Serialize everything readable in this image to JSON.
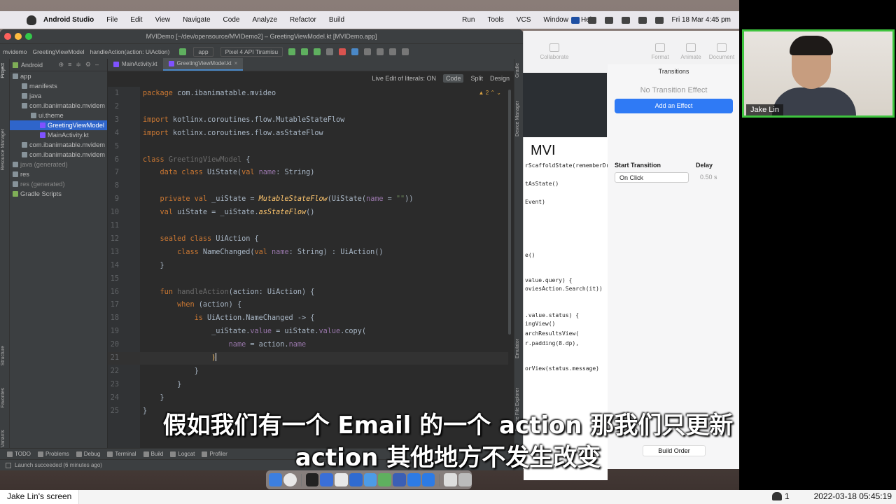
{
  "menubar": {
    "app_name": "Android Studio",
    "items": [
      "File",
      "Edit",
      "View",
      "Navigate",
      "Code",
      "Analyze",
      "Refactor",
      "Build",
      "Run",
      "Tools",
      "VCS",
      "Window",
      "Help"
    ],
    "clock": "Fri 18 Mar  4:45 pm"
  },
  "window": {
    "title": "MVIDemo [~/dev/opensource/MVIDemo2] – GreetingViewModel.kt [MVIDemo.app]"
  },
  "navbar": {
    "crumbs": [
      "mvidemo",
      "GreetingViewModel",
      "handleAction(action: UiAction)"
    ],
    "run_config": "app",
    "device": "Pixel 4 API Tiramisu"
  },
  "project": {
    "view_mode": "Android",
    "tree": [
      {
        "label": "app",
        "indent": 0,
        "icon": "folder-icon"
      },
      {
        "label": "manifests",
        "indent": 1,
        "icon": "folder-icon"
      },
      {
        "label": "java",
        "indent": 1,
        "icon": "folder-icon"
      },
      {
        "label": "com.ibanimatable.mvidem",
        "indent": 1,
        "icon": "package-icon"
      },
      {
        "label": "ui.theme",
        "indent": 2,
        "icon": "package-icon"
      },
      {
        "label": "GreetingViewModel",
        "indent": 3,
        "icon": "kotlin-file-icon",
        "selected": true
      },
      {
        "label": "MainActivity.kt",
        "indent": 3,
        "icon": "kotlin-file-icon"
      },
      {
        "label": "com.ibanimatable.mvidem",
        "indent": 1,
        "icon": "package-icon"
      },
      {
        "label": "com.ibanimatable.mvidem",
        "indent": 1,
        "icon": "package-icon"
      },
      {
        "label": "java (generated)",
        "indent": 0,
        "icon": "folder-icon",
        "gen": true
      },
      {
        "label": "res",
        "indent": 0,
        "icon": "folder-icon"
      },
      {
        "label": "res (generated)",
        "indent": 0,
        "icon": "folder-icon",
        "gen": true
      },
      {
        "label": "Gradle Scripts",
        "indent": 0,
        "icon": "gradle-icon"
      }
    ],
    "side_tabs": [
      "Project",
      "Resource Manager",
      "Structure",
      "Favorites",
      "Build Variants"
    ]
  },
  "editor": {
    "tabs": [
      {
        "label": "MainActivity.kt",
        "active": false
      },
      {
        "label": "GreetingViewModel.kt",
        "active": true
      }
    ],
    "live_edit": "Live Edit of literals: ON",
    "modes": [
      "Code",
      "Split",
      "Design"
    ],
    "warning_count": "2",
    "current_line": 21,
    "lines": [
      [
        [
          "k",
          "package "
        ],
        [
          "t",
          "com.ibanimatable.mvideo"
        ]
      ],
      [],
      [
        [
          "k",
          "import "
        ],
        [
          "t",
          "kotlinx.coroutines.flow.MutableStateFlow"
        ]
      ],
      [
        [
          "k",
          "import "
        ],
        [
          "t",
          "kotlinx.coroutines.flow.asStateFlow"
        ]
      ],
      [],
      [
        [
          "k",
          "class "
        ],
        [
          "g",
          "GreetingViewModel"
        ],
        [
          "t",
          " {"
        ]
      ],
      [
        [
          "t",
          "    "
        ],
        [
          "k",
          "data class "
        ],
        [
          "t",
          "UiState("
        ],
        [
          "k",
          "val "
        ],
        [
          "p",
          "name"
        ],
        [
          "t",
          ": String)"
        ]
      ],
      [],
      [
        [
          "t",
          "    "
        ],
        [
          "k",
          "private val "
        ],
        [
          "t",
          "_uiState = "
        ],
        [
          "i",
          "MutableStateFlow"
        ],
        [
          "t",
          "(UiState("
        ],
        [
          "p",
          "name"
        ],
        [
          "t",
          " = "
        ],
        [
          "s",
          "\"\""
        ],
        [
          "t",
          "))"
        ]
      ],
      [
        [
          "t",
          "    "
        ],
        [
          "k",
          "val "
        ],
        [
          "t",
          "uiState = _uiState."
        ],
        [
          "i",
          "asStateFlow"
        ],
        [
          "t",
          "()"
        ]
      ],
      [],
      [
        [
          "t",
          "    "
        ],
        [
          "k",
          "sealed class "
        ],
        [
          "t",
          "UiAction {"
        ]
      ],
      [
        [
          "t",
          "        "
        ],
        [
          "k",
          "class "
        ],
        [
          "t",
          "NameChanged("
        ],
        [
          "k",
          "val "
        ],
        [
          "p",
          "name"
        ],
        [
          "t",
          ": String) : UiAction()"
        ]
      ],
      [
        [
          "t",
          "    }"
        ]
      ],
      [],
      [
        [
          "t",
          "    "
        ],
        [
          "k",
          "fun "
        ],
        [
          "g",
          "handleAction"
        ],
        [
          "t",
          "(action: UiAction) {"
        ]
      ],
      [
        [
          "t",
          "        "
        ],
        [
          "k",
          "when "
        ],
        [
          "t",
          "(action) {"
        ]
      ],
      [
        [
          "t",
          "            "
        ],
        [
          "k",
          "is "
        ],
        [
          "t",
          "UiAction.NameChanged -> {"
        ]
      ],
      [
        [
          "t",
          "                _uiState."
        ],
        [
          "p",
          "value"
        ],
        [
          "t",
          " = uiState."
        ],
        [
          "p",
          "value"
        ],
        [
          "t",
          ".copy("
        ]
      ],
      [
        [
          "t",
          "                    "
        ],
        [
          "p",
          "name"
        ],
        [
          "t",
          " = action."
        ],
        [
          "p",
          "name"
        ]
      ],
      [
        [
          "t",
          "                "
        ],
        [
          "f",
          ")"
        ]
      ],
      [
        [
          "t",
          "            }"
        ]
      ],
      [
        [
          "t",
          "        }"
        ]
      ],
      [
        [
          "t",
          "    }"
        ]
      ],
      [
        [
          "t",
          "}"
        ]
      ]
    ],
    "right_tabs": [
      "Gradle",
      "Device Manager",
      "Emulator",
      "Device File Explorer"
    ]
  },
  "bottom_tools": [
    "TODO",
    "Problems",
    "Debug",
    "Terminal",
    "Build",
    "Logcat",
    "Profiler"
  ],
  "status": "Launch succeeded (6 minutes ago)",
  "keynote": {
    "toolbar": [
      "Collaborate",
      "Format",
      "Animate",
      "Document"
    ],
    "panel_title": "Transitions",
    "no_effect": "No Transition Effect",
    "add_effect": "Add an Effect",
    "start_transition_label": "Start Transition",
    "start_transition_value": "On Click",
    "delay_label": "Delay",
    "delay_value": "0.50 s",
    "build_order": "Build Order",
    "slide_title": "MVI",
    "slide_code": [
      "rScaffoldState(rememberDra",
      "tAsState()",
      "Event)",
      "e()",
      "value.query) {",
      "oviesAction.Search(it))",
      ".value.status) {",
      "ingView()",
      "archResultsView(",
      "r.padding(8.dp),",
      "orView(status.message)"
    ]
  },
  "webcam": {
    "name": "Jake Lin"
  },
  "subtitles": {
    "line1": "假如我们有一个 Email 的一个 action 那我们只更新",
    "line2": "action 其他地方不发生改变"
  },
  "zoom": {
    "screen_label": "Jake Lin's screen",
    "participants": "1",
    "timestamp": "2022-03-18 05:45:19"
  },
  "colors": {
    "selection": "#2f65ca",
    "keyword": "#cc7832",
    "function": "#ffc66d",
    "string": "#6a8759",
    "property": "#9876aa",
    "accent": "#2f7af5",
    "webcam_border": "#3fc43f"
  }
}
